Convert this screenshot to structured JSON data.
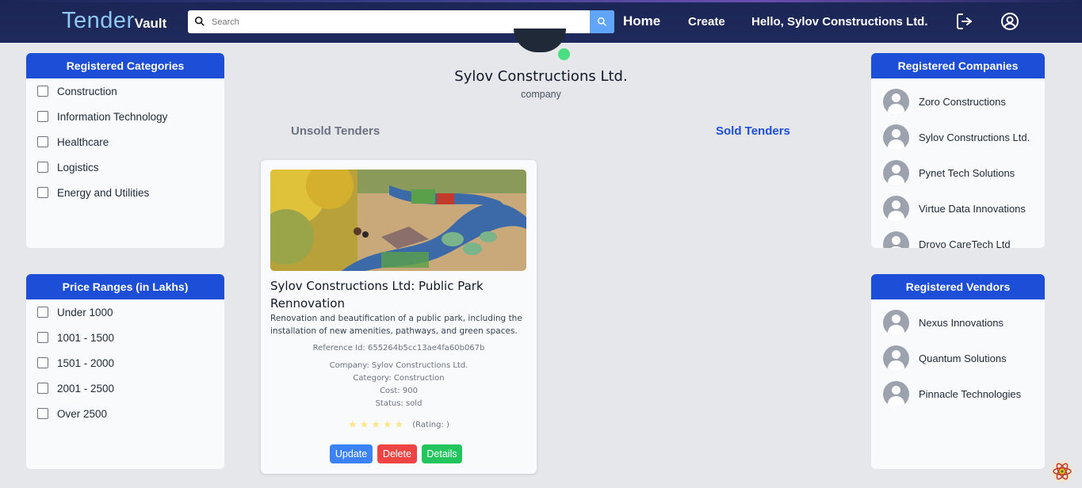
{
  "brand": {
    "big": "Tender",
    "small": "Vault"
  },
  "search": {
    "placeholder": "Search"
  },
  "nav": {
    "home": "Home",
    "create": "Create",
    "hello": "Hello, Sylov Constructions Ltd."
  },
  "categories": {
    "title": "Registered Categories",
    "items": [
      "Construction",
      "Information Technology",
      "Healthcare",
      "Logistics",
      "Energy and Utilities"
    ]
  },
  "prices": {
    "title": "Price Ranges (in Lakhs)",
    "items": [
      "Under 1000",
      "1001 - 1500",
      "1501 - 2000",
      "2001 - 2500",
      "Over 2500"
    ]
  },
  "companies": {
    "title": "Registered Companies",
    "items": [
      "Zoro Constructions",
      "Sylov Constructions Ltd.",
      "Pynet Tech Solutions",
      "Virtue Data Innovations",
      "Droyo CareTech Ltd"
    ]
  },
  "vendors": {
    "title": "Registered Vendors",
    "items": [
      "Nexus Innovations",
      "Quantum Solutions",
      "Pinnacle Technologies"
    ]
  },
  "profile": {
    "name": "Sylov Constructions Ltd.",
    "role": "company"
  },
  "tabs": {
    "unsold": "Unsold Tenders",
    "sold": "Sold Tenders"
  },
  "card": {
    "title": "Sylov Constructions Ltd: Public Park Rennovation",
    "description": "Renovation and beautification of a public park, including the installation of new amenities, pathways, and green spaces.",
    "reference": "Reference Id: 655264b5cc13ae4fa60b067b",
    "company": "Company: Sylov Constructions Ltd.",
    "category": "Category: Construction",
    "cost": "Cost: 900",
    "status": "Status: sold",
    "rating_label": "(Rating: )",
    "rating_stars": 5,
    "buttons": {
      "update": "Update",
      "delete": "Delete",
      "details": "Details"
    }
  },
  "colors": {
    "nav": "#1f2a5c",
    "accent": "#1d4ed8",
    "online": "#4ade80"
  }
}
